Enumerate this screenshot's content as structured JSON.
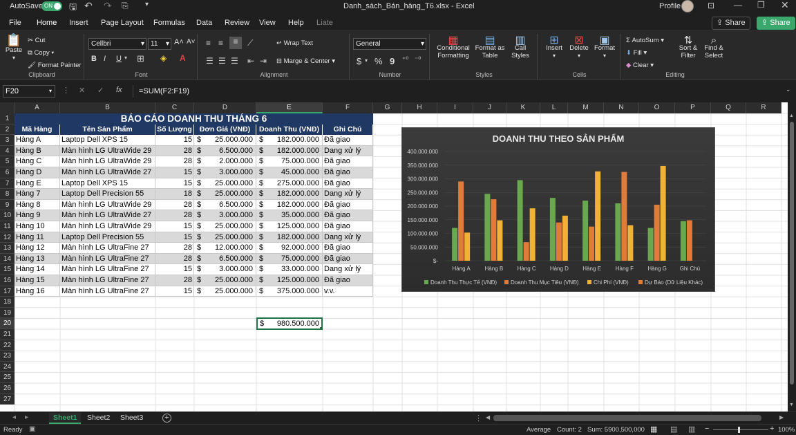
{
  "titlebar": {
    "autosave": "AutoSave",
    "toggle": "ON",
    "filename": "Danh_sách_Bán_hàng_T6.xlsx",
    "separator": "-",
    "app": "Excel",
    "profile": "Profile"
  },
  "tabs": [
    "File",
    "Home",
    "Insert",
    "Page Layout",
    "Formulas",
    "Data",
    "Review",
    "View",
    "Help",
    "Liate"
  ],
  "share": [
    "Share",
    "Share"
  ],
  "ribbon": {
    "clipboard": {
      "paste": "Paste",
      "cut": "Cut",
      "copy": "Copy",
      "format_painter": "Format Painter",
      "label": "Clipboard"
    },
    "font": {
      "name": "Cellbri",
      "size": "11",
      "label": "Font",
      "bold": "B",
      "italic": "I",
      "underline": "U"
    },
    "alignment": {
      "wrap": "Wrap Text",
      "merge": "Marge & Center",
      "label": "Alignment"
    },
    "number": {
      "format": "General",
      "label": "Number",
      "currency": "$",
      "percent": "%",
      "comma": "9"
    },
    "styles": {
      "cond": "Conditional Formatting",
      "fmt_table": "Format as Table",
      "cell_styles": "Call Styles",
      "label": "Styles"
    },
    "cells": {
      "insert": "Insert",
      "delete": "Delete",
      "format": "Format",
      "label": "Cells"
    },
    "editing": {
      "autosum": "AutoSum",
      "fill": "Fill",
      "clear": "Clear",
      "sort": "Sort & Filter",
      "find": "Find & Select",
      "label": "Editing"
    }
  },
  "formula_bar": {
    "name_box": "F20",
    "formula": "=SUM(F2:F19)",
    "fx": "fx"
  },
  "columns": [
    "A",
    "B",
    "C",
    "D",
    "E",
    "F",
    "G",
    "H",
    "I",
    "J",
    "K",
    "L",
    "M",
    "N",
    "O",
    "P",
    "Q",
    "R"
  ],
  "sheet": {
    "title": "BÁO CÁO DOANH THU THÁNG 6",
    "headers": [
      "Mã Hàng",
      "Tên Sản Phẩm",
      "Số Lượng",
      "Đơn Giá (VNĐ)",
      "Doanh Thu (VNĐ)",
      "Ghi Chú"
    ],
    "currency": "$",
    "rows": [
      [
        "Hàng A",
        "Laptop Dell XPS 15",
        "15",
        "25.000.000",
        "182.000.000",
        "Đã giao"
      ],
      [
        "Hàng B",
        "Màn hình LG UltraWide 29",
        "28",
        "6.500.000",
        "182.000.000",
        "Dang xử lý"
      ],
      [
        "Hàng C",
        "Màn hình LG UltraWide 29",
        "28",
        "2.000.000",
        "75.000.000",
        "Đã giao"
      ],
      [
        "Hàng D",
        "Màn hình LG UltraWide 27",
        "15",
        "3.000.000",
        "45.000.000",
        "Đã giao"
      ],
      [
        "Hàng E",
        "Laptop Dell XPS 15",
        "15",
        "25.000.000",
        "275.000.000",
        "Đã giao"
      ],
      [
        "Hàng 7",
        "Laptop Dell Precision 55",
        "18",
        "25.000.000",
        "182.000.000",
        "Dang xử lý"
      ],
      [
        "Hàng 8",
        "Màn hình LG UltraWide 29",
        "28",
        "6.500.000",
        "182.000.000",
        "Đã giao"
      ],
      [
        "Hàng 9",
        "Màn hình LG UltraWide 27",
        "28",
        "3.000.000",
        "35.000.000",
        "Đã giao"
      ],
      [
        "Hàng 10",
        "Màn hình LG UltraWide 29",
        "15",
        "25.000.000",
        "125.000.000",
        "Đã giao"
      ],
      [
        "Hàng 11",
        "Laptop Dell Precision 55",
        "15",
        "25.000.000",
        "182.000.000",
        "Dang xử lý"
      ],
      [
        "Hàng 12",
        "Màn hình LG UltraFine 27",
        "28",
        "12.000.000",
        "92.000.000",
        "Đã giao"
      ],
      [
        "Hàng 13",
        "Màn hình LG UltraFine 27",
        "28",
        "6.500.000",
        "75.000.000",
        "Đã giao"
      ],
      [
        "Hàng 14",
        "Màn hình LG UltraFine 27",
        "15",
        "3.000.000",
        "33.000.000",
        "Dang xử lý"
      ],
      [
        "Hàng 15",
        "Màn hình LG UltraFine 27",
        "28",
        "25.000.000",
        "125.000.000",
        "Đã giao"
      ],
      [
        "Hàng 16",
        "Màn hình LG UltraFine 27",
        "15",
        "25.000.000",
        "375.000.000",
        "v.v."
      ]
    ],
    "total": "980.500.000"
  },
  "chart_data": {
    "type": "bar",
    "title": "DOANH THU THEO SẢN PHẨM",
    "categories": [
      "Hàng A",
      "Hàng B",
      "Hàng C",
      "Hàng D",
      "Hàng E",
      "Hàng F",
      "Hàng G",
      "Ghi Chú"
    ],
    "ylim": [
      0,
      400000000
    ],
    "yticks": [
      "400.000.000",
      "350.000.000",
      "300.000.000",
      "250.000.000",
      "200.000.000",
      "150.000.000",
      "100.000.000",
      "50.000.000",
      "$-"
    ],
    "series": [
      {
        "name": "Doanh Thu Thực Tế (VNĐ)",
        "color": "#6aa84f",
        "values": [
          120000000,
          245000000,
          295000000,
          230000000,
          220000000,
          210000000,
          120000000,
          145000000
        ]
      },
      {
        "name": "Doanh Thu Mục Tiêu (VNĐ)",
        "color": "#e07b39",
        "values": [
          290000000,
          225000000,
          68000000,
          140000000,
          125000000,
          325000000,
          205000000,
          148000000
        ]
      },
      {
        "name": "Chi Phí (VNĐ)",
        "color": "#f1b134",
        "values": [
          103000000,
          148000000,
          192000000,
          165000000,
          327000000,
          130000000,
          347000000,
          null
        ]
      },
      {
        "name": "Dự Báo (Dữ Liệu Khác)",
        "color": null,
        "values": []
      }
    ],
    "legend": "bottom"
  },
  "sheets": [
    "Sheet1",
    "Sheet2",
    "Sheet3"
  ],
  "status": {
    "ready": "Ready",
    "average": "Average",
    "count": "Count: 2",
    "sum": "Sum: 5900,500,000",
    "zoom": "100%"
  }
}
